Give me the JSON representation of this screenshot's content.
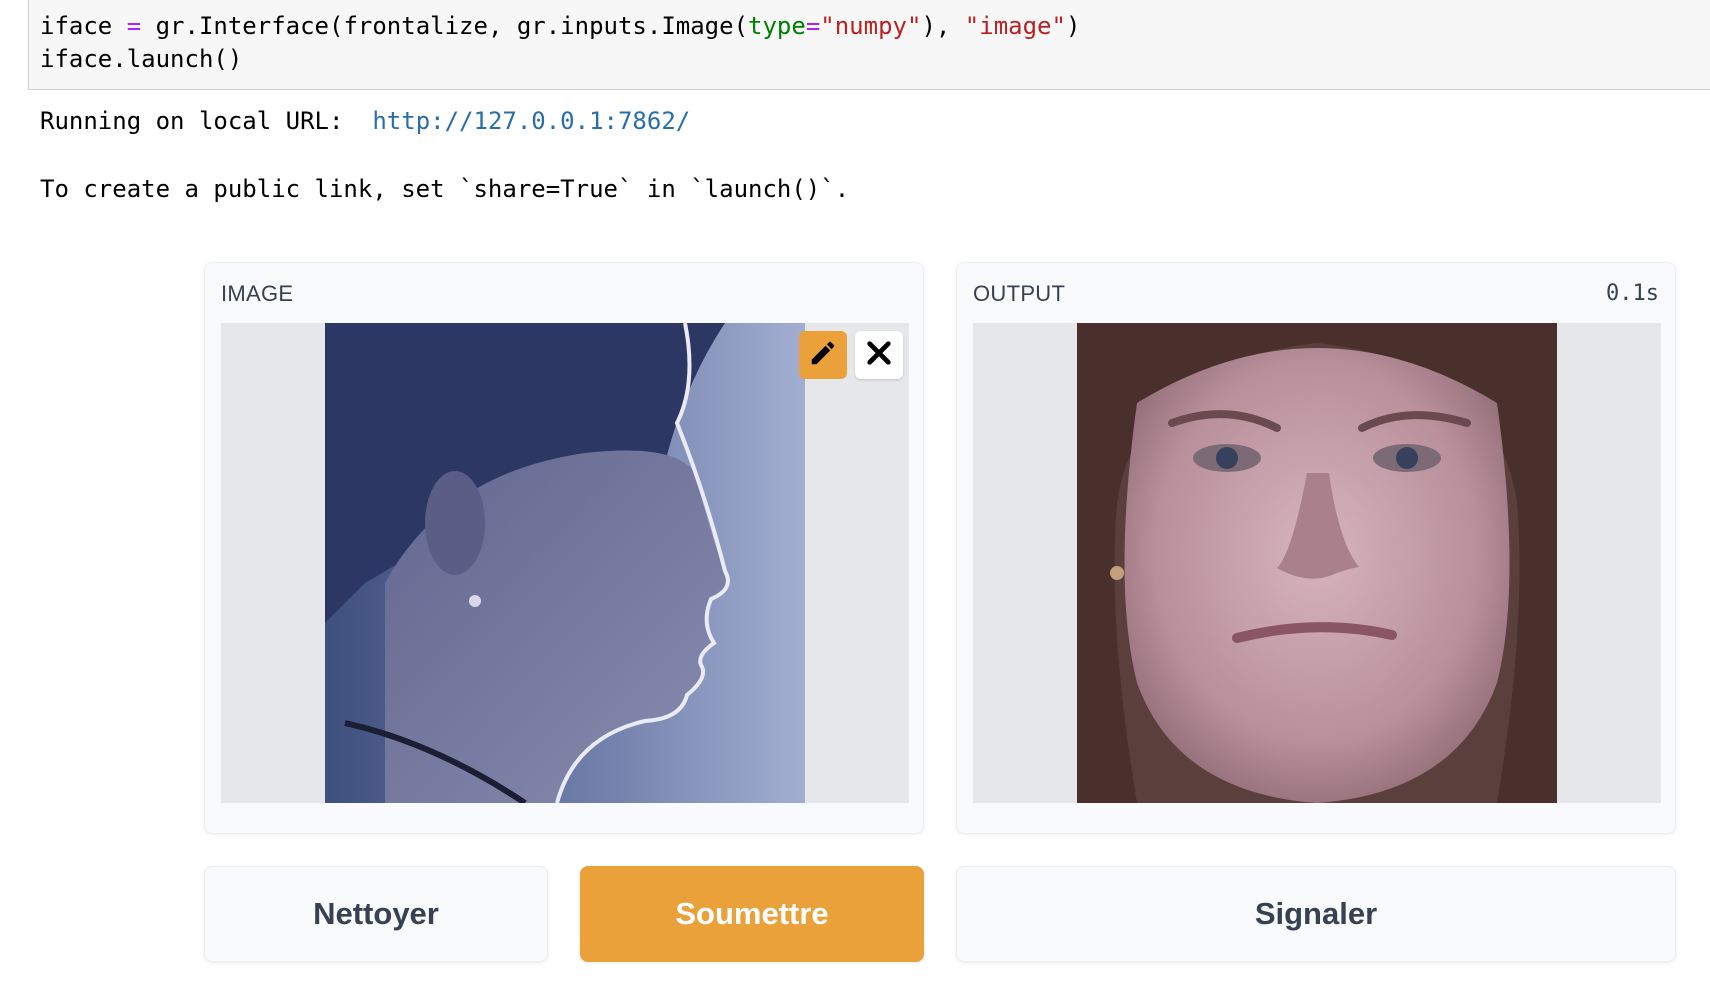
{
  "code": {
    "line1": {
      "a": "iface ",
      "op": "=",
      "b": " gr.Interface(frontalize, gr.inputs.Image(",
      "kw": "type",
      "eq": "=",
      "s1": "\"numpy\"",
      "c": "), ",
      "s2": "\"image\"",
      "d": ")"
    },
    "line2": "iface.launch()"
  },
  "output": {
    "url_prefix": "Running on local URL:  ",
    "url": "http://127.0.0.1:7862/",
    "share_hint": "To create a public link, set `share=True` in `launch()`."
  },
  "input_panel": {
    "label": "IMAGE",
    "edit_icon": "pencil-icon",
    "clear_icon": "close-icon"
  },
  "output_panel": {
    "label": "OUTPUT",
    "time": "0.1s"
  },
  "buttons": {
    "clear": "Nettoyer",
    "submit": "Soumettre",
    "flag": "Signaler"
  },
  "colors": {
    "accent": "#eaa13a",
    "link": "#296eaa",
    "panel_bg": "#f9fafb",
    "image_bg": "#e5e7eb"
  }
}
